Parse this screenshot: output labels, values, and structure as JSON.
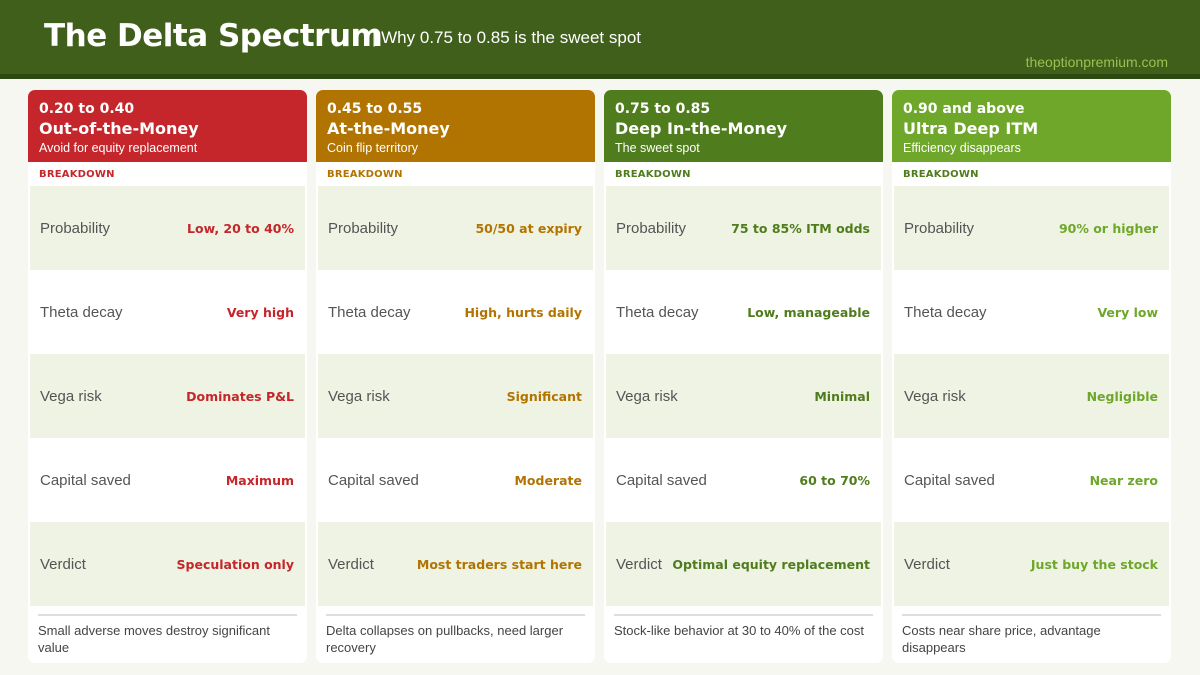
{
  "header": {
    "title": "The Delta Spectrum",
    "subtitle": "| Why 0.75 to 0.85 is the sweet spot",
    "site": "theoptionpremium.com"
  },
  "colors": {
    "header_bg": "#3f5f1b",
    "otm": "#c4262b",
    "atm": "#b27400",
    "deep_itm": "#4f7c1c",
    "ultra_itm": "#6ea72a",
    "row_shade": "#eef3e3"
  },
  "cards": [
    {
      "range": "0.20 to 0.40",
      "name": "Out-of-the-Money",
      "tagline": "Avoid for equity replacement",
      "breakdown_label": "BREAKDOWN",
      "rows": [
        {
          "label": "Probability",
          "value": "Low, 20 to 40%"
        },
        {
          "label": "Theta decay",
          "value": "Very high"
        },
        {
          "label": "Vega risk",
          "value": "Dominates P&L"
        },
        {
          "label": "Capital saved",
          "value": "Maximum"
        },
        {
          "label": "Verdict",
          "value": "Speculation only"
        }
      ],
      "note": "Small adverse moves destroy significant value"
    },
    {
      "range": "0.45 to 0.55",
      "name": "At-the-Money",
      "tagline": "Coin flip territory",
      "breakdown_label": "BREAKDOWN",
      "rows": [
        {
          "label": "Probability",
          "value": "50/50 at expiry"
        },
        {
          "label": "Theta decay",
          "value": "High, hurts daily"
        },
        {
          "label": "Vega risk",
          "value": "Significant"
        },
        {
          "label": "Capital saved",
          "value": "Moderate"
        },
        {
          "label": "Verdict",
          "value": "Most traders start here"
        }
      ],
      "note": "Delta collapses on pullbacks, need larger recovery"
    },
    {
      "range": "0.75 to 0.85",
      "name": "Deep In-the-Money",
      "tagline": "The sweet spot",
      "breakdown_label": "BREAKDOWN",
      "rows": [
        {
          "label": "Probability",
          "value": "75 to 85% ITM odds"
        },
        {
          "label": "Theta decay",
          "value": "Low, manageable"
        },
        {
          "label": "Vega risk",
          "value": "Minimal"
        },
        {
          "label": "Capital saved",
          "value": "60 to 70%"
        },
        {
          "label": "Verdict",
          "value": "Optimal equity replacement"
        }
      ],
      "note": "Stock-like behavior at 30 to 40% of the cost"
    },
    {
      "range": "0.90 and above",
      "name": "Ultra Deep ITM",
      "tagline": "Efficiency disappears",
      "breakdown_label": "BREAKDOWN",
      "rows": [
        {
          "label": "Probability",
          "value": "90% or higher"
        },
        {
          "label": "Theta decay",
          "value": "Very low"
        },
        {
          "label": "Vega risk",
          "value": "Negligible"
        },
        {
          "label": "Capital saved",
          "value": "Near zero"
        },
        {
          "label": "Verdict",
          "value": "Just buy the stock"
        }
      ],
      "note": "Costs near share price, advantage disappears"
    }
  ]
}
